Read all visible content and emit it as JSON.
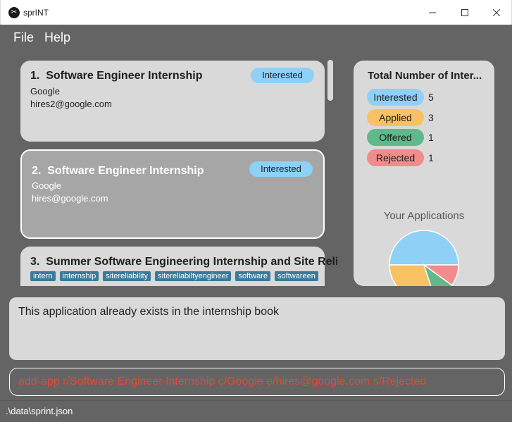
{
  "window": {
    "title": "sprINT",
    "icon": "sprint-app-icon"
  },
  "menu": {
    "file": "File",
    "help": "Help"
  },
  "applications": [
    {
      "index": "1.",
      "title": "Software Engineer Internship",
      "company": "Google",
      "email": "hires2@google.com",
      "status": "Interested"
    },
    {
      "index": "2.",
      "title": "Software Engineer Internship",
      "company": "Google",
      "email": "hires@google.com",
      "status": "Interested"
    },
    {
      "index": "3.",
      "title": "Summer Software Engineering Internship and Site Reli",
      "tags": [
        "intern",
        "internship",
        "sitereliability",
        "sitereliabiltyengineer",
        "software",
        "softwareen"
      ]
    }
  ],
  "stats": {
    "title": "Total Number of Inter...",
    "rows": [
      {
        "label": "Interested",
        "count": "5",
        "color": "#8fd0f7"
      },
      {
        "label": "Applied",
        "count": "3",
        "color": "#f8c162"
      },
      {
        "label": "Offered",
        "count": "1",
        "color": "#5fb98a"
      },
      {
        "label": "Rejected",
        "count": "1",
        "color": "#f28b8b"
      }
    ],
    "pie_title": "Your Applications"
  },
  "chart_data": {
    "type": "pie",
    "categories": [
      "Interested",
      "Applied",
      "Offered",
      "Rejected"
    ],
    "values": [
      5,
      3,
      1,
      1
    ],
    "colors": [
      "#8fd0f7",
      "#f8c162",
      "#5fb98a",
      "#f28b8b"
    ],
    "title": "Your Applications"
  },
  "result": {
    "message": "This application already exists in the internship book"
  },
  "command": {
    "value": "add-app r/Software Engineer Internship c/Google e/hires@google.com s/Rejected"
  },
  "statusbar": {
    "path": ".\\data\\sprint.json"
  }
}
